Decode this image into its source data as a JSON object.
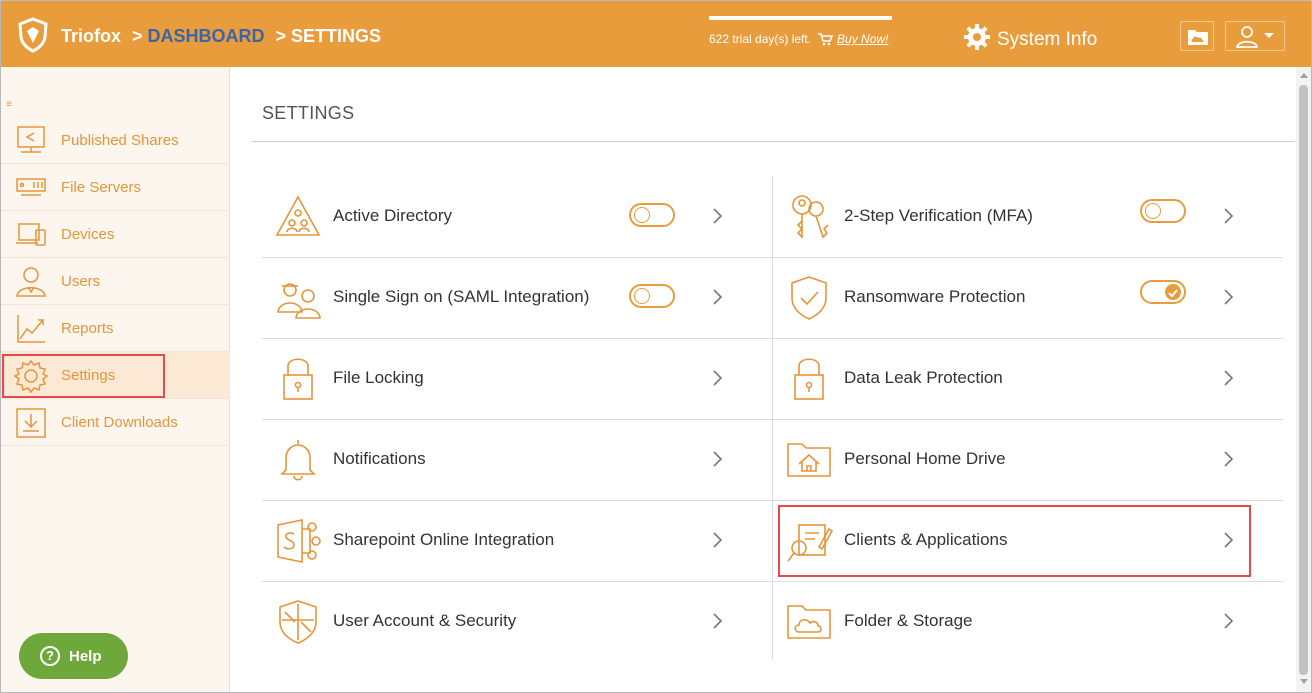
{
  "header": {
    "brand": "Triofox",
    "crumb_sep": ">",
    "crumb_dashboard": "DASHBOARD",
    "crumb_settings": "SETTINGS",
    "trial_text": "622 trial day(s) left.",
    "buy_now": "Buy Now!",
    "system_info": "System Info"
  },
  "sidebar": {
    "collapse_glyph": "≡",
    "items": [
      {
        "label": "Published Shares",
        "icon": "published-shares-icon"
      },
      {
        "label": "File Servers",
        "icon": "file-servers-icon"
      },
      {
        "label": "Devices",
        "icon": "devices-icon"
      },
      {
        "label": "Users",
        "icon": "users-icon"
      },
      {
        "label": "Reports",
        "icon": "reports-icon"
      },
      {
        "label": "Settings",
        "icon": "settings-icon",
        "active": true
      },
      {
        "label": "Client Downloads",
        "icon": "client-downloads-icon"
      }
    ],
    "help": "Help"
  },
  "main": {
    "title": "SETTINGS",
    "tiles": [
      {
        "label": "Active Directory",
        "icon": "active-directory-icon",
        "toggle": "off"
      },
      {
        "label": "2-Step Verification (MFA)",
        "icon": "keys-icon",
        "toggle": "off"
      },
      {
        "label": "Single Sign on (SAML Integration)",
        "icon": "sso-icon",
        "toggle": "off"
      },
      {
        "label": "Ransomware Protection",
        "icon": "shield-check-icon",
        "toggle": "on"
      },
      {
        "label": "File Locking",
        "icon": "padlock-icon"
      },
      {
        "label": "Data Leak Protection",
        "icon": "padlock-icon"
      },
      {
        "label": "Notifications",
        "icon": "bell-icon"
      },
      {
        "label": "Personal Home Drive",
        "icon": "home-folder-icon"
      },
      {
        "label": "Sharepoint Online Integration",
        "icon": "sharepoint-icon"
      },
      {
        "label": "Clients & Applications",
        "icon": "clients-applications-icon"
      },
      {
        "label": "User Account & Security",
        "icon": "shield-grid-icon"
      },
      {
        "label": "Folder & Storage",
        "icon": "cloud-folder-icon"
      }
    ]
  },
  "colors": {
    "accent": "#e89c3c",
    "link_blue": "#3c64a8",
    "highlight_red": "#e24b4b",
    "help_green": "#6fa83a"
  }
}
